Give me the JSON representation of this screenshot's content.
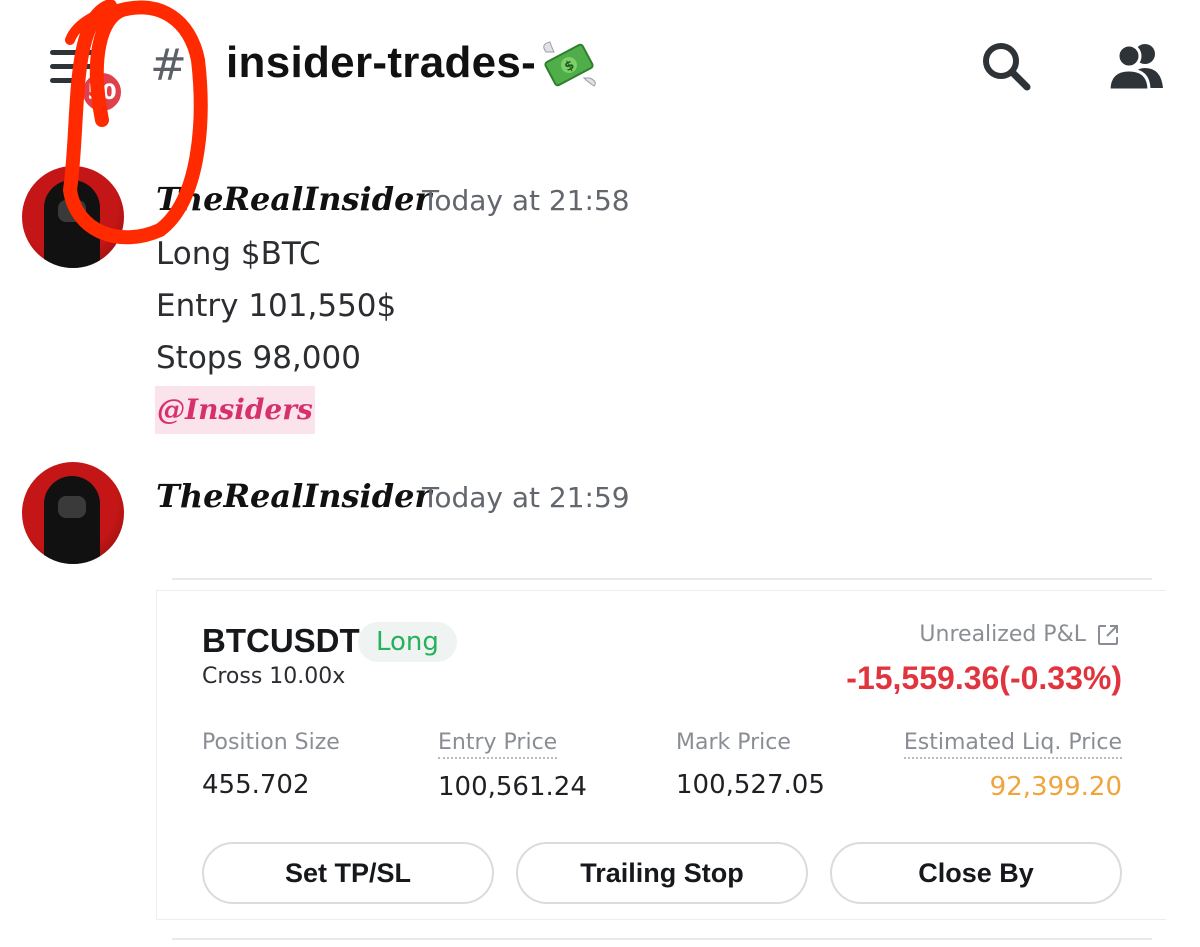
{
  "header": {
    "channel_name": "insider-trades-",
    "unread_badge": "50",
    "icons": [
      "menu-icon",
      "hash-icon",
      "money-with-wings-icon",
      "search-icon",
      "members-icon"
    ]
  },
  "messages": [
    {
      "author": "TheRealInsider",
      "timestamp": "Today at 21:58",
      "lines": [
        "Long $BTC",
        "Entry 101,550$",
        "Stops 98,000"
      ],
      "mention": "@Insiders"
    },
    {
      "author": "TheRealInsider",
      "timestamp": "Today at 21:59"
    }
  ],
  "trade_card": {
    "symbol": "BTCUSDT",
    "side": "Long",
    "margin_mode": "Cross 10.00x",
    "pnl_label": "Unrealized P&L",
    "pnl_value": "-15,559.36(-0.33%)",
    "fields": [
      {
        "label": "Position Size",
        "value": "455.702"
      },
      {
        "label": "Entry Price",
        "value": "100,561.24"
      },
      {
        "label": "Mark Price",
        "value": "100,527.05"
      },
      {
        "label": "Estimated Liq. Price",
        "value": "92,399.20"
      }
    ],
    "buttons": [
      "Set TP/SL",
      "Trailing Stop",
      "Close By"
    ]
  },
  "colors": {
    "annotation_red": "#ff2a00",
    "badge": "#e0404b",
    "long_green": "#24b35a",
    "loss_red": "#e0353e",
    "liq_orange": "#f0a43c",
    "mention_bg": "#fbe3ec",
    "mention_text": "#d6316d"
  }
}
